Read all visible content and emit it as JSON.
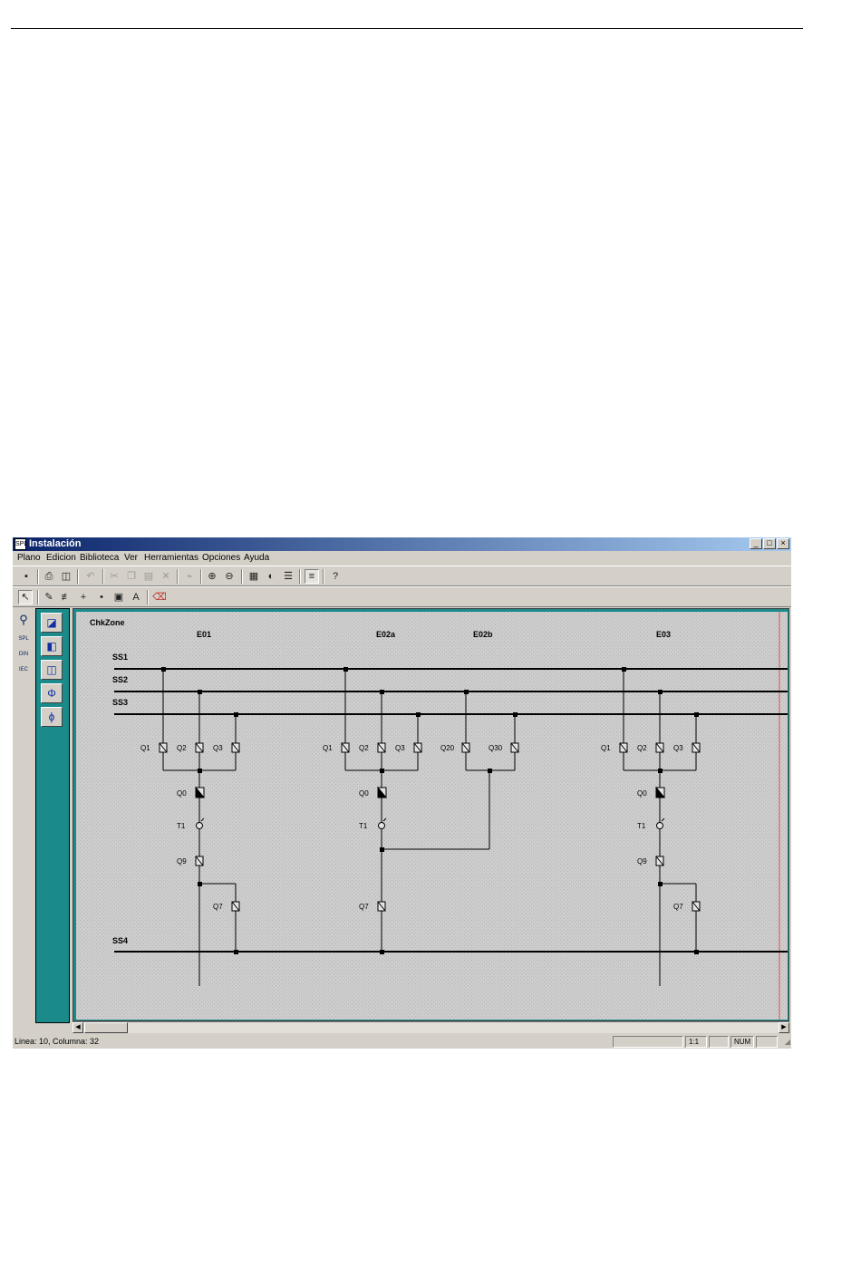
{
  "window": {
    "title": "Instalación",
    "app_icon_text": "SPL",
    "controls": [
      "_",
      "□",
      "×"
    ]
  },
  "menu": [
    "Plano",
    "Edicion",
    "Biblioteca",
    "Ver",
    "Herramientas",
    "Opciones",
    "Ayuda"
  ],
  "toolbar1": [
    {
      "icon": "save-icon",
      "glyph": "▪"
    },
    {
      "icon": "print-icon",
      "glyph": "⎙"
    },
    {
      "icon": "print-preview-icon",
      "glyph": "◫"
    },
    {
      "icon": "undo-icon",
      "glyph": "↶"
    },
    {
      "icon": "cut-icon",
      "glyph": "✂"
    },
    {
      "icon": "copy-icon",
      "glyph": "❐"
    },
    {
      "icon": "paste-icon",
      "glyph": "▤"
    },
    {
      "icon": "delete-icon",
      "glyph": "✕"
    },
    {
      "icon": "link-icon",
      "glyph": "⌁"
    },
    {
      "icon": "zoom-in-icon",
      "glyph": "⊕"
    },
    {
      "icon": "zoom-out-icon",
      "glyph": "⊖"
    },
    {
      "icon": "calculator-icon",
      "glyph": "▦"
    },
    {
      "icon": "contrast-icon",
      "glyph": "◐"
    },
    {
      "icon": "layers-icon",
      "glyph": "☰"
    },
    {
      "icon": "properties-icon",
      "glyph": "≡"
    },
    {
      "icon": "help-icon",
      "glyph": "?"
    }
  ],
  "toolbar2": [
    {
      "icon": "pointer-icon",
      "glyph": "↖"
    },
    {
      "icon": "pencil-icon",
      "glyph": "✎"
    },
    {
      "icon": "busbar-icon",
      "glyph": "≢"
    },
    {
      "icon": "cross-icon",
      "glyph": "+"
    },
    {
      "icon": "node-icon",
      "glyph": "•"
    },
    {
      "icon": "text-frame-icon",
      "glyph": "▣"
    },
    {
      "icon": "text-icon",
      "glyph": "A"
    },
    {
      "icon": "eraser-icon",
      "glyph": "⌫"
    }
  ],
  "left_strip": [
    {
      "icon": "search-icon",
      "glyph": "⚲"
    },
    {
      "icon": "spl-icon",
      "glyph": "SPL"
    },
    {
      "icon": "din-icon",
      "glyph": "DIN"
    },
    {
      "icon": "iec-icon",
      "glyph": "IEC"
    }
  ],
  "palette": [
    {
      "icon": "breaker-tool-icon",
      "glyph": "◪"
    },
    {
      "icon": "disconnector-tool-icon",
      "glyph": "◧"
    },
    {
      "icon": "bay-tool-icon",
      "glyph": "◫"
    },
    {
      "icon": "transformer-tool-icon",
      "glyph": "Φ"
    },
    {
      "icon": "ct-tool-icon",
      "glyph": "ϕ"
    }
  ],
  "diagram": {
    "zone_label": "ChkZone",
    "bays": [
      "E01",
      "E02a",
      "E02b",
      "E03"
    ],
    "busbars": [
      "SS1",
      "SS2",
      "SS3",
      "SS4"
    ],
    "bay_e01": [
      "Q1",
      "Q2",
      "Q3",
      "Q0",
      "T1",
      "Q9",
      "Q7"
    ],
    "bay_e02a": [
      "Q1",
      "Q2",
      "Q3",
      "Q0",
      "T1",
      "Q7"
    ],
    "bay_e02b": [
      "Q20",
      "Q30"
    ],
    "bay_e03": [
      "Q1",
      "Q2",
      "Q3",
      "Q0",
      "T1",
      "Q9",
      "Q7"
    ]
  },
  "status": {
    "position": "Linea: 10, Columna: 32",
    "zoom": "1:1",
    "num": "NUM"
  },
  "colors": {
    "title_start": "#0a246a",
    "title_end": "#a6caf0",
    "palette_bg": "#1a8a8a",
    "canvas_bg": "#c9c9c9",
    "margin_line": "#e05050"
  }
}
